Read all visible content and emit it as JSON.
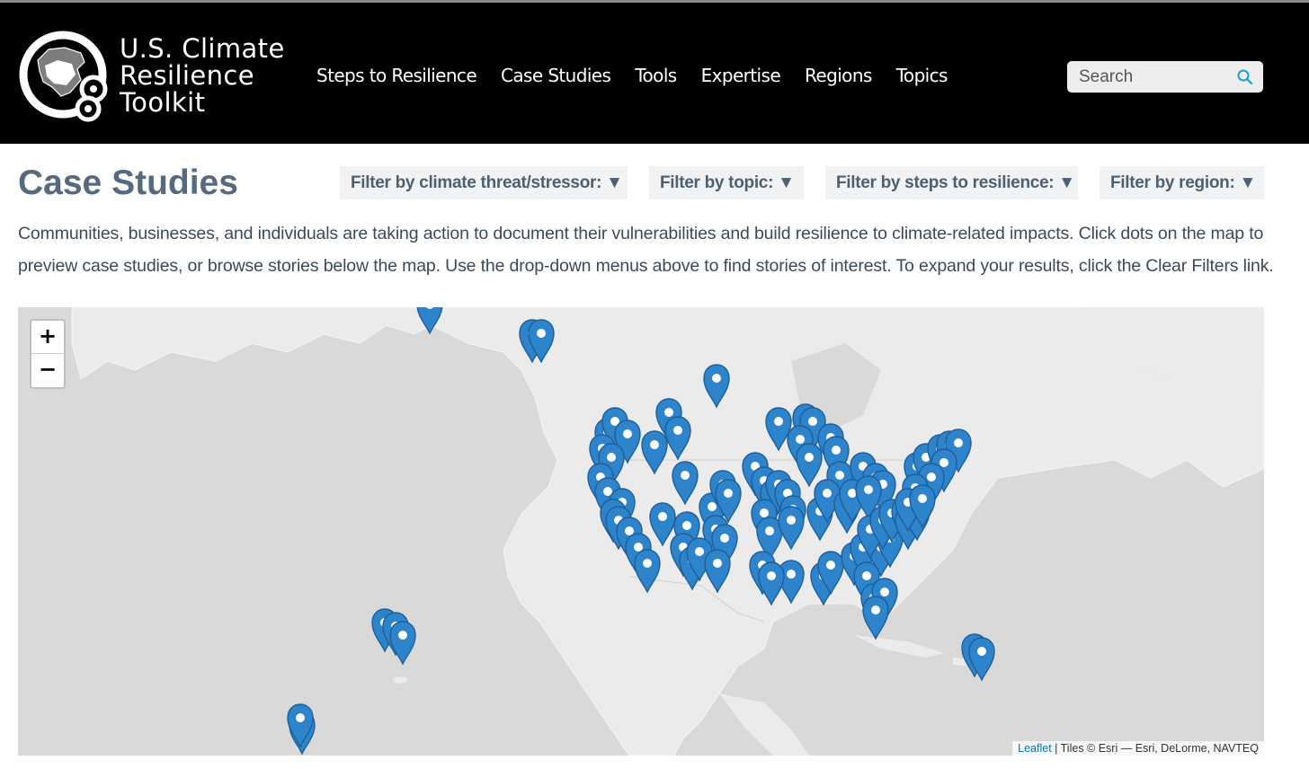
{
  "header": {
    "logo_lines": [
      "U.S. Climate",
      "Resilience",
      "Toolkit"
    ],
    "nav": [
      "Steps to Resilience",
      "Case Studies",
      "Tools",
      "Expertise",
      "Regions",
      "Topics"
    ],
    "search_placeholder": "Search"
  },
  "page": {
    "title": "Case Studies",
    "filters": [
      "Filter by climate threat/stressor: ▼",
      "Filter by topic: ▼",
      "Filter by steps to resilience: ▼",
      "Filter by region: ▼"
    ],
    "description": "Communities, businesses, and individuals are taking action to document their vulnerabilities and build resilience to climate-related impacts. Click dots on the map to preview case studies, or browse stories below the map. Use the drop-down menus above to find stories of interest. To expand your results, click the Clear Filters link."
  },
  "map": {
    "zoom_in": "+",
    "zoom_out": "−",
    "attribution_link": "Leaflet",
    "attribution_text": " | Tiles © Esri — Esri, DeLorme, NAVTEQ",
    "marker_color": "#2e84cb",
    "water_color": "#d9d9d9",
    "land_color": "#ebebeb"
  }
}
